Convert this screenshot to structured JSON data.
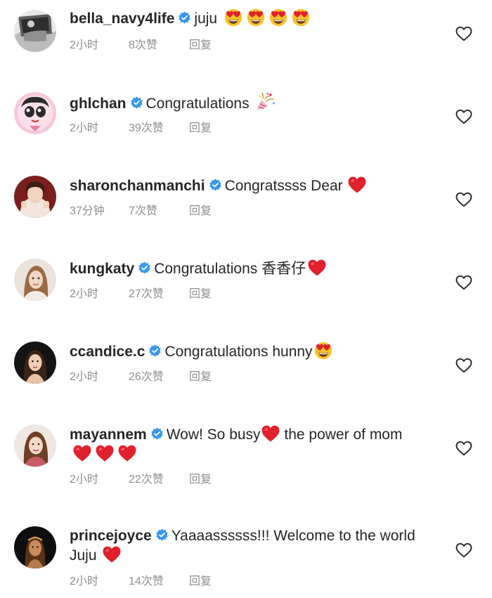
{
  "colors": {
    "text": "#262626",
    "meta": "#8e8e8e",
    "verified": "#3897f0",
    "heart_emoji": "#e0212d",
    "like_outline": "#262626"
  },
  "comments": [
    {
      "username": "bella_navy4life",
      "verified": true,
      "text": "juju",
      "emojis": [
        "heart-eyes-emoji",
        "heart-eyes-emoji",
        "heart-eyes-emoji",
        "heart-eyes-emoji"
      ],
      "time": "2小时",
      "likes": "8次赞",
      "reply": "回复"
    },
    {
      "username": "ghlchan",
      "verified": true,
      "text": "Congratulations",
      "emojis": [
        "party-popper-emoji"
      ],
      "time": "2小时",
      "likes": "39次赞",
      "reply": "回复"
    },
    {
      "username": "sharonchanmanchi",
      "verified": true,
      "text": "Congratssss Dear",
      "emojis": [
        "red-heart-emoji"
      ],
      "time": "37分钟",
      "likes": "7次赞",
      "reply": "回复"
    },
    {
      "username": "kungkaty",
      "verified": true,
      "text": "Congratulations 香香仔",
      "emojis": [
        "red-heart-emoji"
      ],
      "time": "2小时",
      "likes": "27次赞",
      "reply": "回复"
    },
    {
      "username": "ccandice.c",
      "verified": true,
      "text": "Congratulations hunny",
      "emojis": [
        "heart-eyes-emoji"
      ],
      "time": "2小时",
      "likes": "26次赞",
      "reply": "回复"
    },
    {
      "username": "mayannem",
      "verified": true,
      "text": "Wow! So busy",
      "text2": "the power of mom",
      "emojis": [
        "red-heart-emoji",
        "red-heart-emoji",
        "red-heart-emoji",
        "red-heart-emoji"
      ],
      "time": "2小时",
      "likes": "22次赞",
      "reply": "回复"
    },
    {
      "username": "princejoyce",
      "verified": true,
      "text": "Yaaaassssss!!! Welcome to the world Juju",
      "emojis": [
        "red-heart-emoji"
      ],
      "time": "2小时",
      "likes": "14次赞",
      "reply": "回复"
    }
  ]
}
